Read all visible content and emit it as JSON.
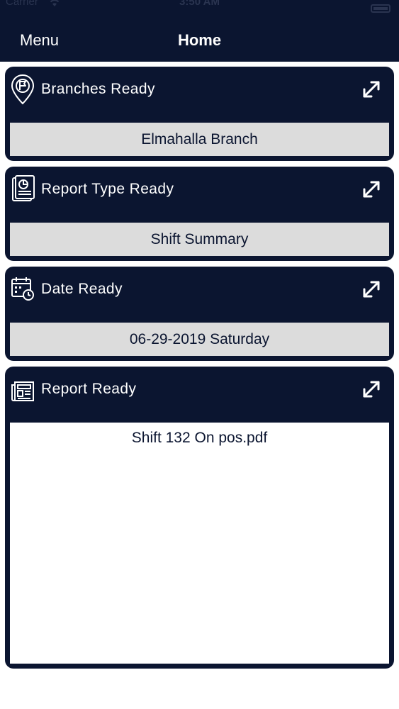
{
  "status_bar": {
    "carrier": "Carrier",
    "time": "3:50 AM"
  },
  "header": {
    "menu_label": "Menu",
    "title": "Home"
  },
  "cards": [
    {
      "label": "Branches Ready",
      "value": "Elmahalla Branch",
      "icon": "location-pin-icon"
    },
    {
      "label": "Report Type Ready",
      "value": "Shift Summary",
      "icon": "report-document-icon"
    },
    {
      "label": "Date Ready",
      "value": "06-29-2019 Saturday",
      "icon": "calendar-clock-icon"
    },
    {
      "label": "Report Ready",
      "icon": "newspaper-icon",
      "file": "Shift 132 On pos.pdf"
    }
  ],
  "colors": {
    "navy": "#0b1530",
    "value_bg": "#dcdcdc",
    "text_on_dark": "#ffffff"
  }
}
